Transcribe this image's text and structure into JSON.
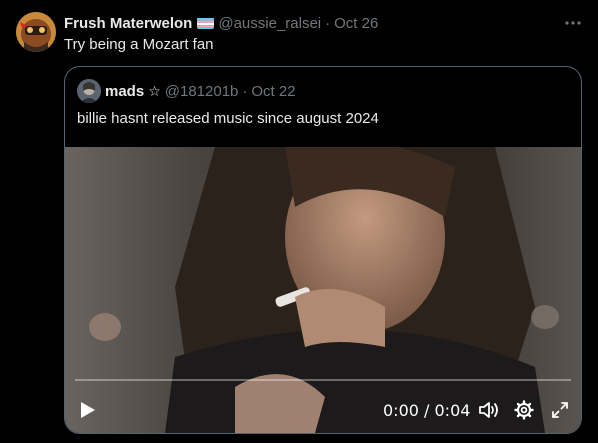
{
  "tweet": {
    "author_name": "Frush Materwelon",
    "handle": "@aussie_ralsei",
    "separator": "·",
    "date": "Oct 26",
    "text": "Try being a Mozart fan",
    "flag_icon": "transgender-flag-icon",
    "more_icon": "more-options-icon"
  },
  "quote": {
    "author_name": "mads",
    "star": "☆",
    "handle": "@181201b",
    "separator": "·",
    "date": "Oct 22",
    "text": "billie hasnt released music since august 2024"
  },
  "video": {
    "current_time": "0:00",
    "time_separator": "/",
    "duration": "0:04",
    "time_display": "0:00 / 0:04",
    "progress": 0,
    "play_icon": "play-icon",
    "volume_icon": "volume-icon",
    "settings_icon": "settings-gear-icon",
    "fullscreen_icon": "fullscreen-icon"
  },
  "colors": {
    "background": "#000000",
    "text": "#e7e9ea",
    "muted": "#71767b",
    "border": "#536471"
  }
}
